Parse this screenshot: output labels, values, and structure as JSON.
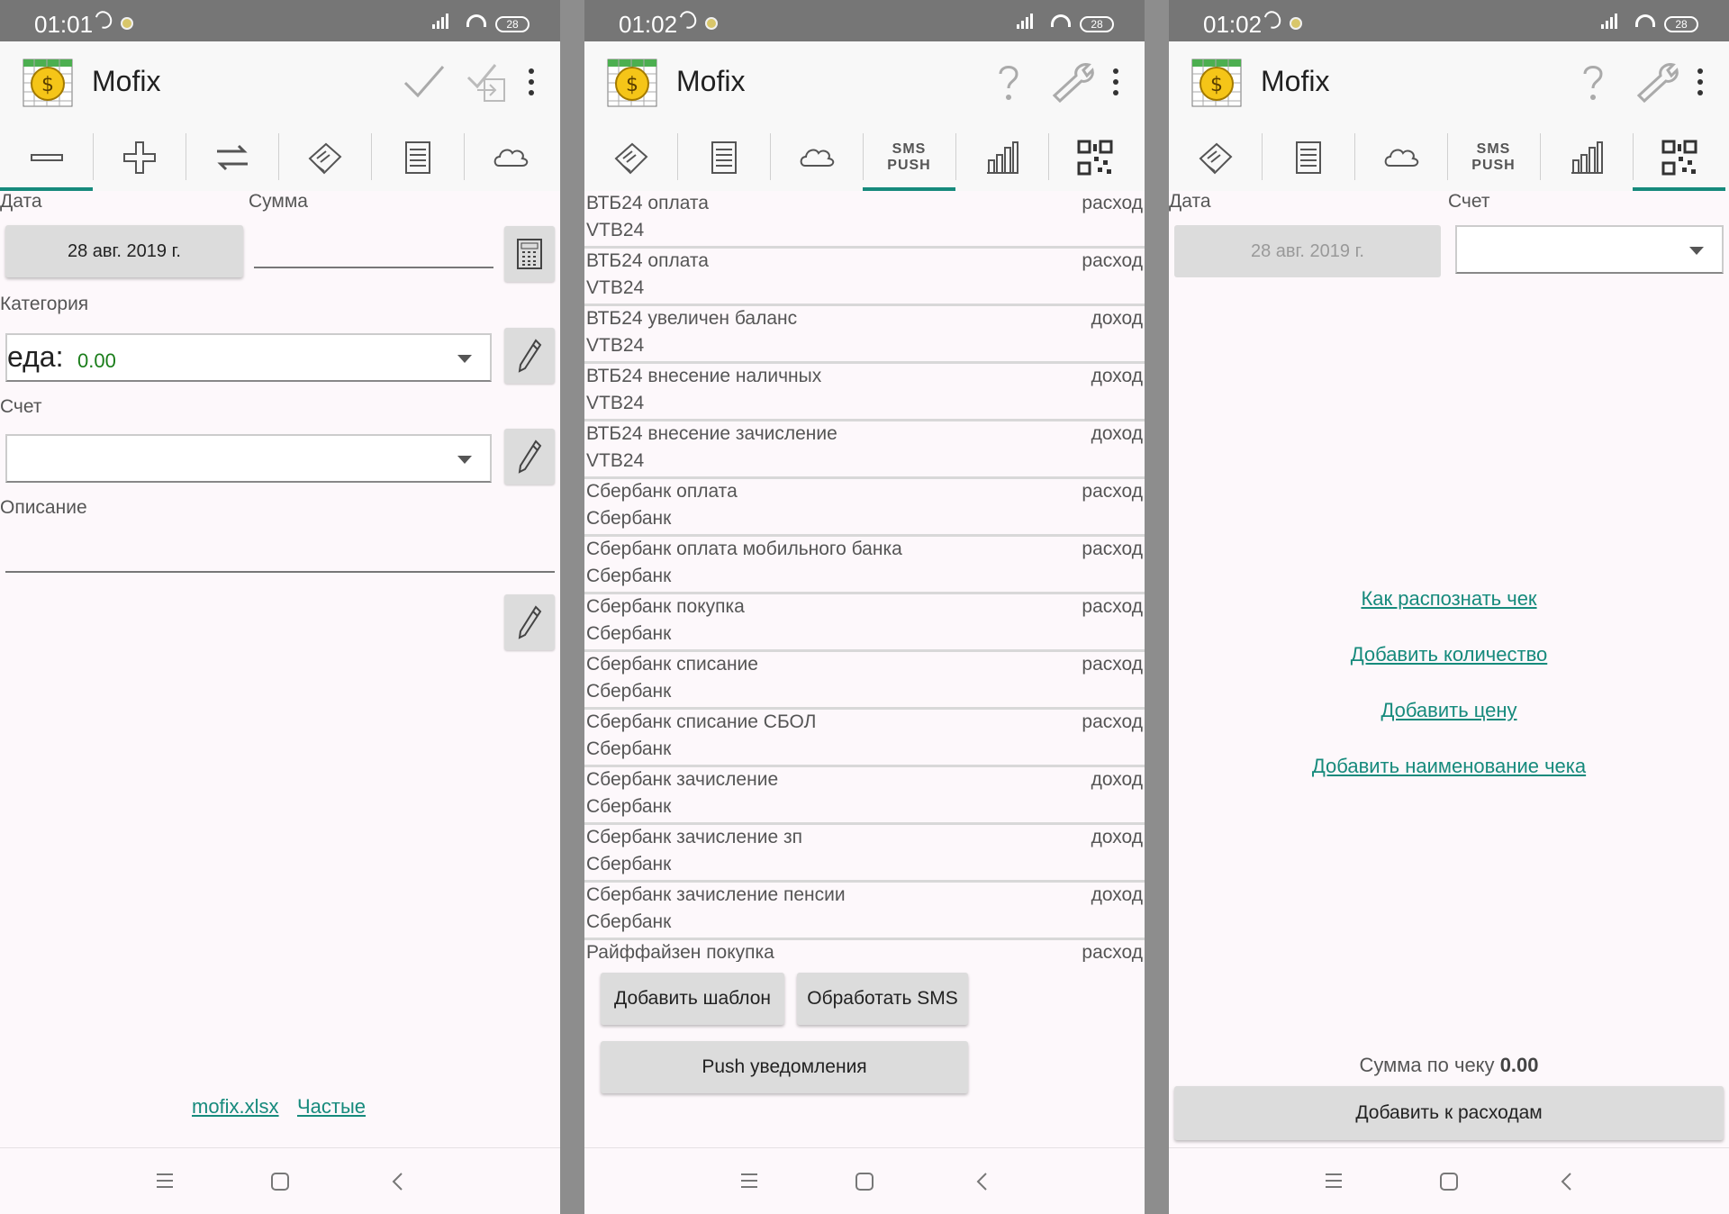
{
  "app": {
    "title": "Mofix"
  },
  "screens": [
    {
      "status": {
        "time": "01:01",
        "battery": "28"
      },
      "form": {
        "date_label": "Дата",
        "sum_label": "Сумма",
        "date_value": "28 авг. 2019 г.",
        "category_label": "Категория",
        "category_value": "еда:",
        "category_amount": "0.00",
        "account_label": "Счет",
        "description_label": "Описание"
      },
      "footer_links": {
        "file": "mofix.xlsx",
        "frequent": "Частые"
      }
    },
    {
      "status": {
        "time": "01:02",
        "battery": "28"
      },
      "templates": [
        {
          "title": "ВТБ24 оплата",
          "bank": "VTB24",
          "type": "расход"
        },
        {
          "title": "ВТБ24 оплата",
          "bank": "VTB24",
          "type": "расход"
        },
        {
          "title": "ВТБ24 увеличен баланс",
          "bank": "VTB24",
          "type": "доход"
        },
        {
          "title": "ВТБ24 внесение наличных",
          "bank": "VTB24",
          "type": "доход"
        },
        {
          "title": "ВТБ24 внесение зачисление",
          "bank": "VTB24",
          "type": "доход"
        },
        {
          "title": "Сбербанк оплата",
          "bank": "Сбербанк",
          "type": "расход"
        },
        {
          "title": "Сбербанк оплата мобильного банка",
          "bank": "Сбербанк",
          "type": "расход"
        },
        {
          "title": "Сбербанк покупка",
          "bank": "Сбербанк",
          "type": "расход"
        },
        {
          "title": "Сбербанк списание",
          "bank": "Сбербанк",
          "type": "расход"
        },
        {
          "title": "Сбербанк списание СБОЛ",
          "bank": "Сбербанк",
          "type": "расход"
        },
        {
          "title": "Сбербанк зачисление",
          "bank": "Сбербанк",
          "type": "доход"
        },
        {
          "title": "Сбербанк зачисление зп",
          "bank": "Сбербанк",
          "type": "доход"
        },
        {
          "title": "Сбербанк зачисление пенсии",
          "bank": "Сбербанк",
          "type": "доход"
        },
        {
          "title": "Райффайзен покупка",
          "bank": "",
          "type": "расход"
        }
      ],
      "buttons": {
        "add_template": "Добавить шаблон",
        "process_sms": "Обработать SMS",
        "push": "Push уведомления"
      },
      "sms_tab": [
        "SMS",
        "PUSH"
      ]
    },
    {
      "status": {
        "time": "01:02",
        "battery": "28"
      },
      "form": {
        "date_label": "Дата",
        "account_label": "Счет",
        "date_value": "28 авг. 2019 г."
      },
      "links": [
        "Как распознать чек",
        "Добавить количество",
        "Добавить цену",
        "Добавить наименование чека"
      ],
      "total_label": "Сумма по чеку",
      "total_value": "0.00",
      "add_button": "Добавить к расходам",
      "sms_tab": [
        "SMS",
        "PUSH"
      ]
    }
  ],
  "colors": {
    "accent": "#168a7c",
    "statusbar": "#767676",
    "button": "#dcdcdc"
  }
}
